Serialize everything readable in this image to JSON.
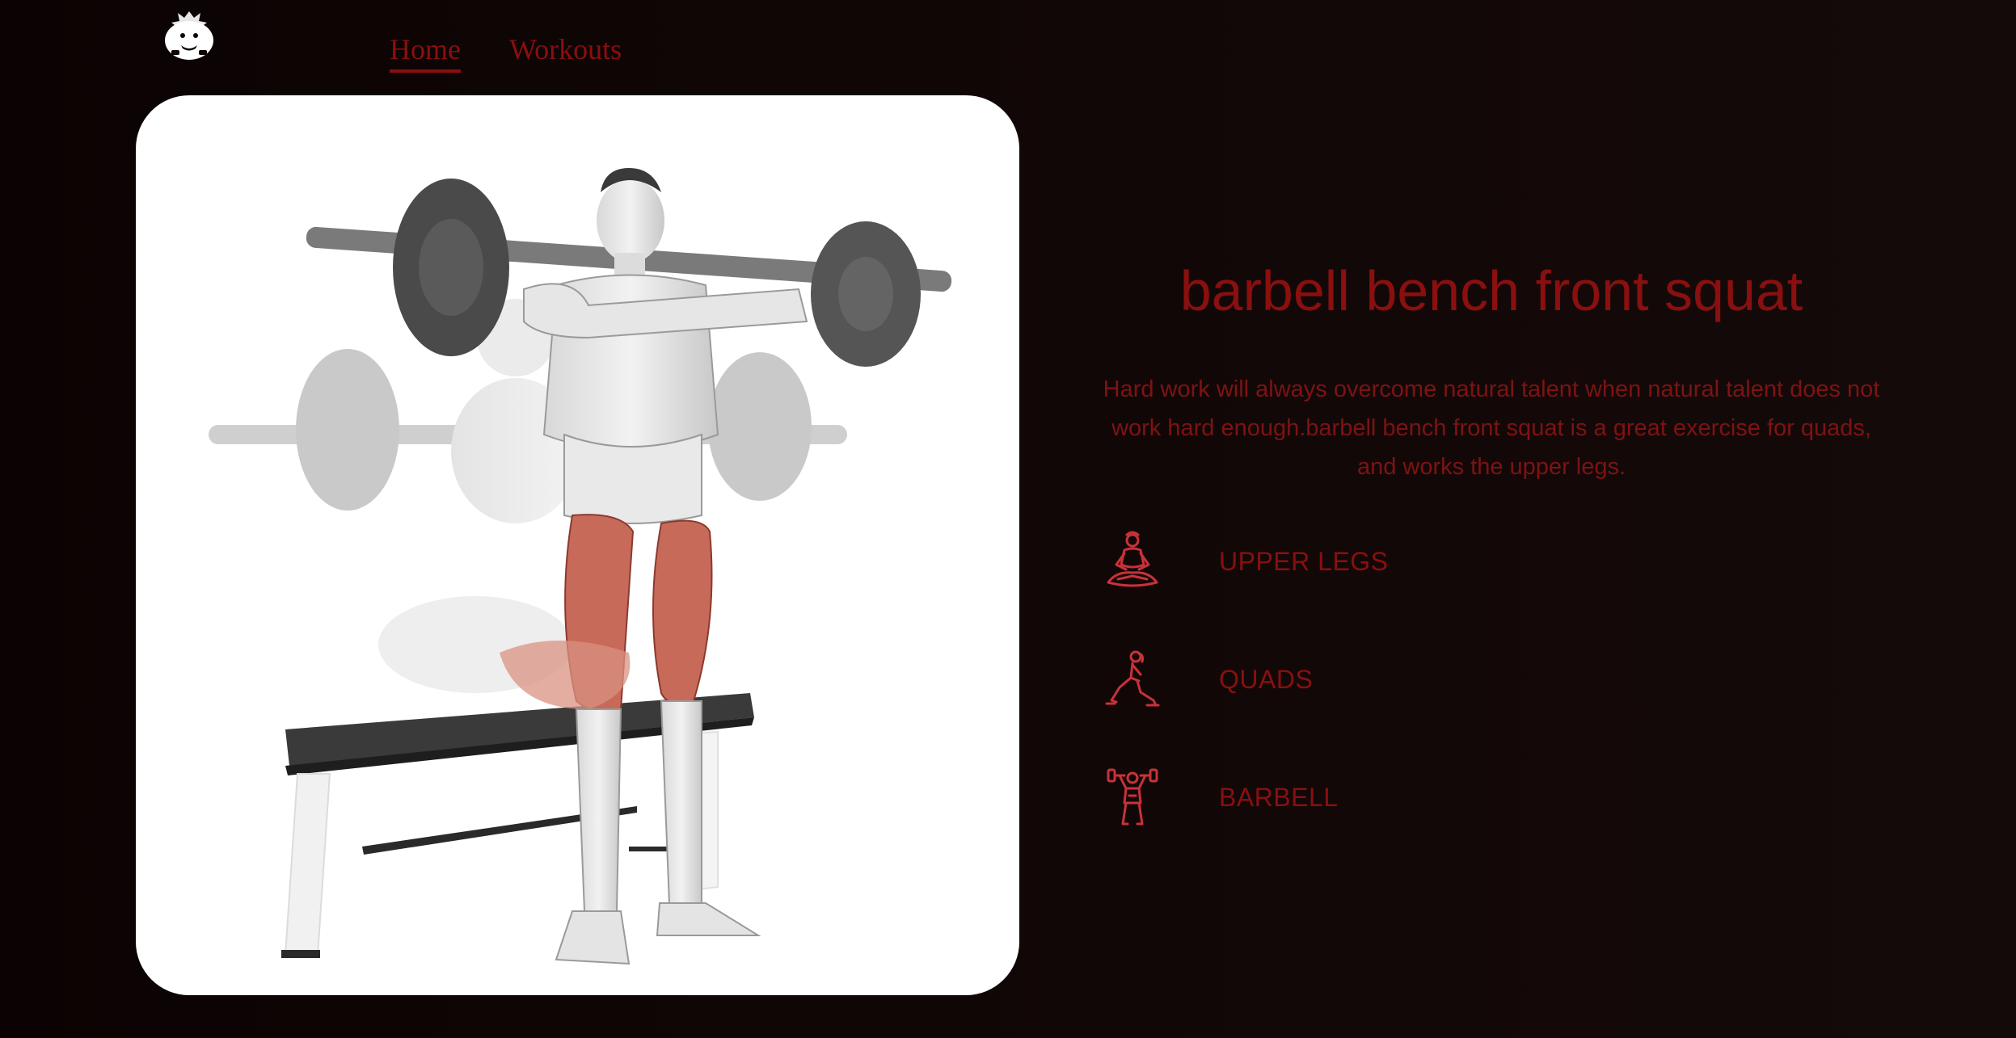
{
  "colors": {
    "accent": "#8a0f0f",
    "text_dim": "#7d1313",
    "icon": "#c8323a",
    "background": "#0d0505",
    "card": "#ffffff"
  },
  "nav": {
    "home_label": "Home",
    "workouts_label": "Workouts"
  },
  "exercise": {
    "image_alt": "barbell bench front squat",
    "title": "barbell bench front squat",
    "description": "Hard work will always overcome natural talent when natural talent does not work hard enough.barbell bench front squat is a great exercise for quads, and works the upper legs."
  },
  "targets": [
    {
      "icon": "yoga-person-icon",
      "label": "UPPER LEGS"
    },
    {
      "icon": "lunge-person-icon",
      "label": "QUADS"
    },
    {
      "icon": "dumbbell-lift-icon",
      "label": "BARBELL"
    }
  ]
}
